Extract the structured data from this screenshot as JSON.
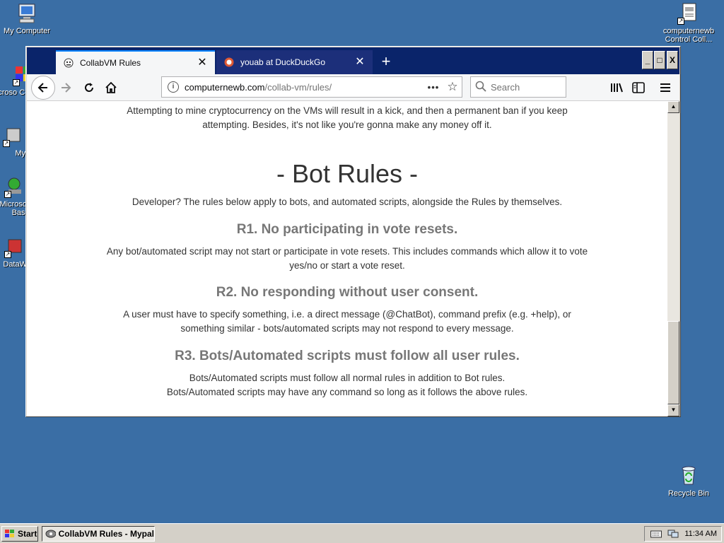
{
  "desktop": {
    "icons": [
      {
        "label": "My Computer"
      },
      {
        "label": "computernewb Control Coll..."
      },
      {
        "label": "Microso C++"
      },
      {
        "label": "My"
      },
      {
        "label": "Microso Basi"
      },
      {
        "label": "DataW"
      },
      {
        "label": "Recycle Bin"
      }
    ]
  },
  "browser": {
    "tabs": [
      {
        "title": "CollabVM Rules",
        "close": "✕"
      },
      {
        "title": "youab at DuckDuckGo",
        "close": "✕"
      }
    ],
    "new_tab": "+",
    "window_controls": {
      "minimize": "_",
      "maximize": "□",
      "close": "X"
    },
    "url": {
      "host": "computernewb.com",
      "path": "/collab-vm/rules/"
    },
    "search_placeholder": "Search",
    "icons": {
      "back": "back-arrow-icon",
      "forward": "forward-arrow-icon",
      "reload": "reload-icon",
      "home": "home-icon",
      "library": "library-icon",
      "sidebar": "sidebar-icon",
      "menu": "hamburger-menu-icon"
    }
  },
  "page": {
    "intro_line1": "Attempting to mine cryptocurrency on the VMs will result in a kick, and then a permanent ban if you keep",
    "intro_line2": "attempting. Besides, it's not like you're gonna make any money off it.",
    "section_title": "- Bot Rules -",
    "section_desc": "Developer? The rules below apply to bots, and automated scripts, alongside the Rules by themselves.",
    "rules": [
      {
        "heading": "R1. No participating in vote resets.",
        "line1": "Any bot/automated script may not start or participate in vote resets. This includes commands which allow it to vote",
        "line2": "yes/no or start a vote reset."
      },
      {
        "heading": "R2. No responding without user consent.",
        "line1": "A user must have to specify something, i.e. a direct message (@ChatBot), command prefix (e.g. +help), or",
        "line2": "something similar - bots/automated scripts may not respond to every message."
      },
      {
        "heading": "R3. Bots/Automated scripts must follow all user rules.",
        "line1": "Bots/Automated scripts must follow all normal rules in addition to Bot rules.",
        "line2": "Bots/Automated scripts may have any command so long as it follows the above rules."
      }
    ]
  },
  "taskbar": {
    "start_label": "Start",
    "task_label": "CollabVM Rules - Mypal",
    "clock": "11:34 AM"
  }
}
